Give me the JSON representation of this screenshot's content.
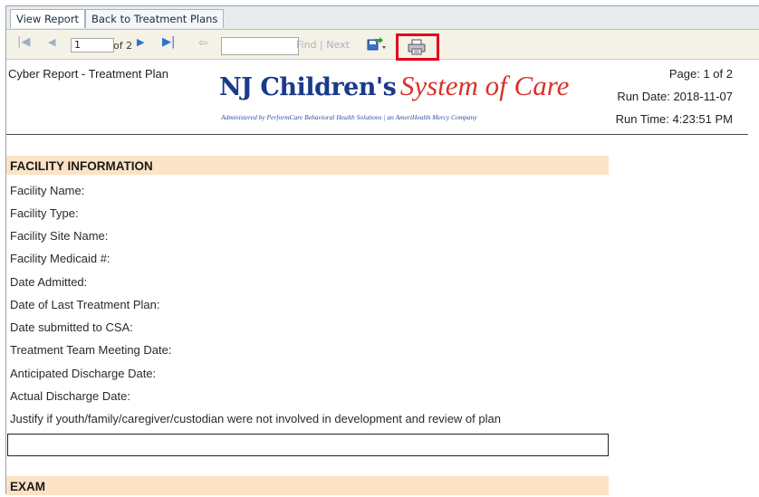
{
  "tabs": [
    {
      "label": "View Report"
    },
    {
      "label": "Back to Treatment Plans"
    }
  ],
  "toolbar": {
    "page_value": "1",
    "of_label": "of 2",
    "find_value": "",
    "find_label": "Find",
    "separator": "|",
    "next_label": "Next",
    "icons": [
      "first-page-icon",
      "prev-page-icon",
      "next-page-icon",
      "last-page-icon",
      "back-icon",
      "export-icon",
      "print-icon"
    ]
  },
  "report": {
    "title": "Cyber Report - Treatment Plan",
    "brand_main": "NJ Children's",
    "brand_script": "System of Care",
    "brand_sub": "Administered by PerformCare Behavioral Health Solutions  |  an AmeriHealth Mercy Company",
    "page": "Page: 1 of 2",
    "run_date": "Run Date: 2018-11-07",
    "run_time": "Run Time: 4:23:51 PM"
  },
  "facility": {
    "heading": "FACILITY INFORMATION",
    "fields": [
      "Facility Name:",
      "Facility Type:",
      "Facility Site Name:",
      "Facility Medicaid #:",
      "Date Admitted:",
      "Date of Last Treatment Plan:",
      "Date submitted to CSA:",
      "Treatment Team Meeting Date:",
      "Anticipated Discharge Date:",
      "Actual Discharge Date:",
      "Justify if youth/family/caregiver/custodian were not involved in development and review of plan"
    ]
  },
  "exam": {
    "heading": "EXAM"
  },
  "colors": {
    "section_bg": "#fce3c6",
    "highlight": "#e3001b",
    "brand_blue": "#1a3a8a",
    "brand_red": "#d8322b"
  }
}
